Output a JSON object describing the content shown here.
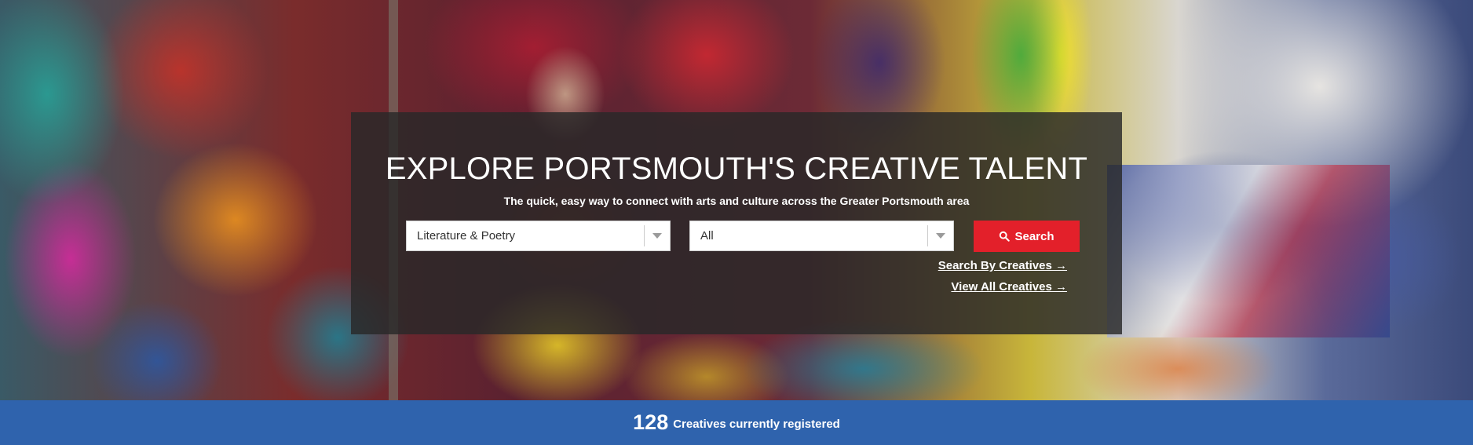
{
  "hero": {
    "title": "EXPLORE PORTSMOUTH'S CREATIVE TALENT",
    "subtitle": "The quick, easy way to connect with arts and culture across the Greater Portsmouth area",
    "category_select": {
      "value": "Literature & Poetry"
    },
    "location_select": {
      "value": "All"
    },
    "search_button": {
      "label": "Search",
      "icon": "search-icon"
    },
    "links": [
      {
        "label": "Search By Creatives →"
      },
      {
        "label": "View All Creatives →"
      }
    ]
  },
  "stats": {
    "count": "128",
    "label": "Creatives currently registered"
  },
  "colors": {
    "accent_red": "#e3202a",
    "stats_blue": "#2f63ad",
    "panel_overlay": "rgba(40,40,40,0.82)"
  }
}
